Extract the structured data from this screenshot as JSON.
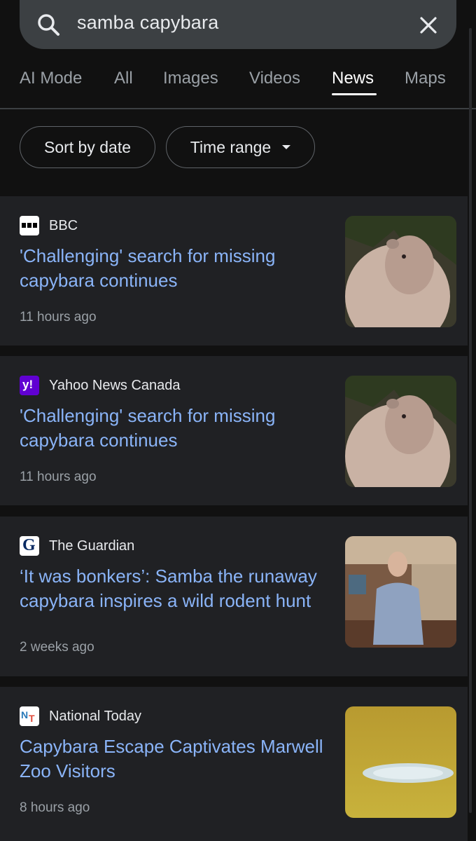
{
  "search": {
    "query": "samba capybara"
  },
  "tabs": [
    {
      "label": "AI Mode"
    },
    {
      "label": "All"
    },
    {
      "label": "Images"
    },
    {
      "label": "Videos"
    },
    {
      "label": "News",
      "active": true
    },
    {
      "label": "Maps"
    }
  ],
  "filters": {
    "sort_label": "Sort by date",
    "time_label": "Time range"
  },
  "results": [
    {
      "source": "BBC",
      "title": "'Challenging' search for missing capybara continues",
      "time": "11 hours ago",
      "favicon": "bbc-favicon",
      "thumbnail": "capybara-photo"
    },
    {
      "source": "Yahoo News Canada",
      "title": "'Challenging' search for missing capybara continues",
      "time": "11 hours ago",
      "favicon": "yahoo-favicon",
      "thumbnail": "capybara-photo"
    },
    {
      "source": "The Guardian",
      "title": "‘It was bonkers’: Samba the runaway capybara inspires a wild rodent hunt",
      "time": "2 weeks ago",
      "favicon": "guardian-favicon",
      "thumbnail": "woman-in-shop-photo"
    },
    {
      "source": "National Today",
      "title": "Capybara Escape Captivates Marwell Zoo Visitors",
      "time": "8 hours ago",
      "favicon": "national-today-favicon",
      "thumbnail": "grassland-pond-photo"
    }
  ],
  "colors": {
    "background": "#111111",
    "card": "#202124",
    "link": "#8ab4f8",
    "muted": "#9aa0a6"
  }
}
